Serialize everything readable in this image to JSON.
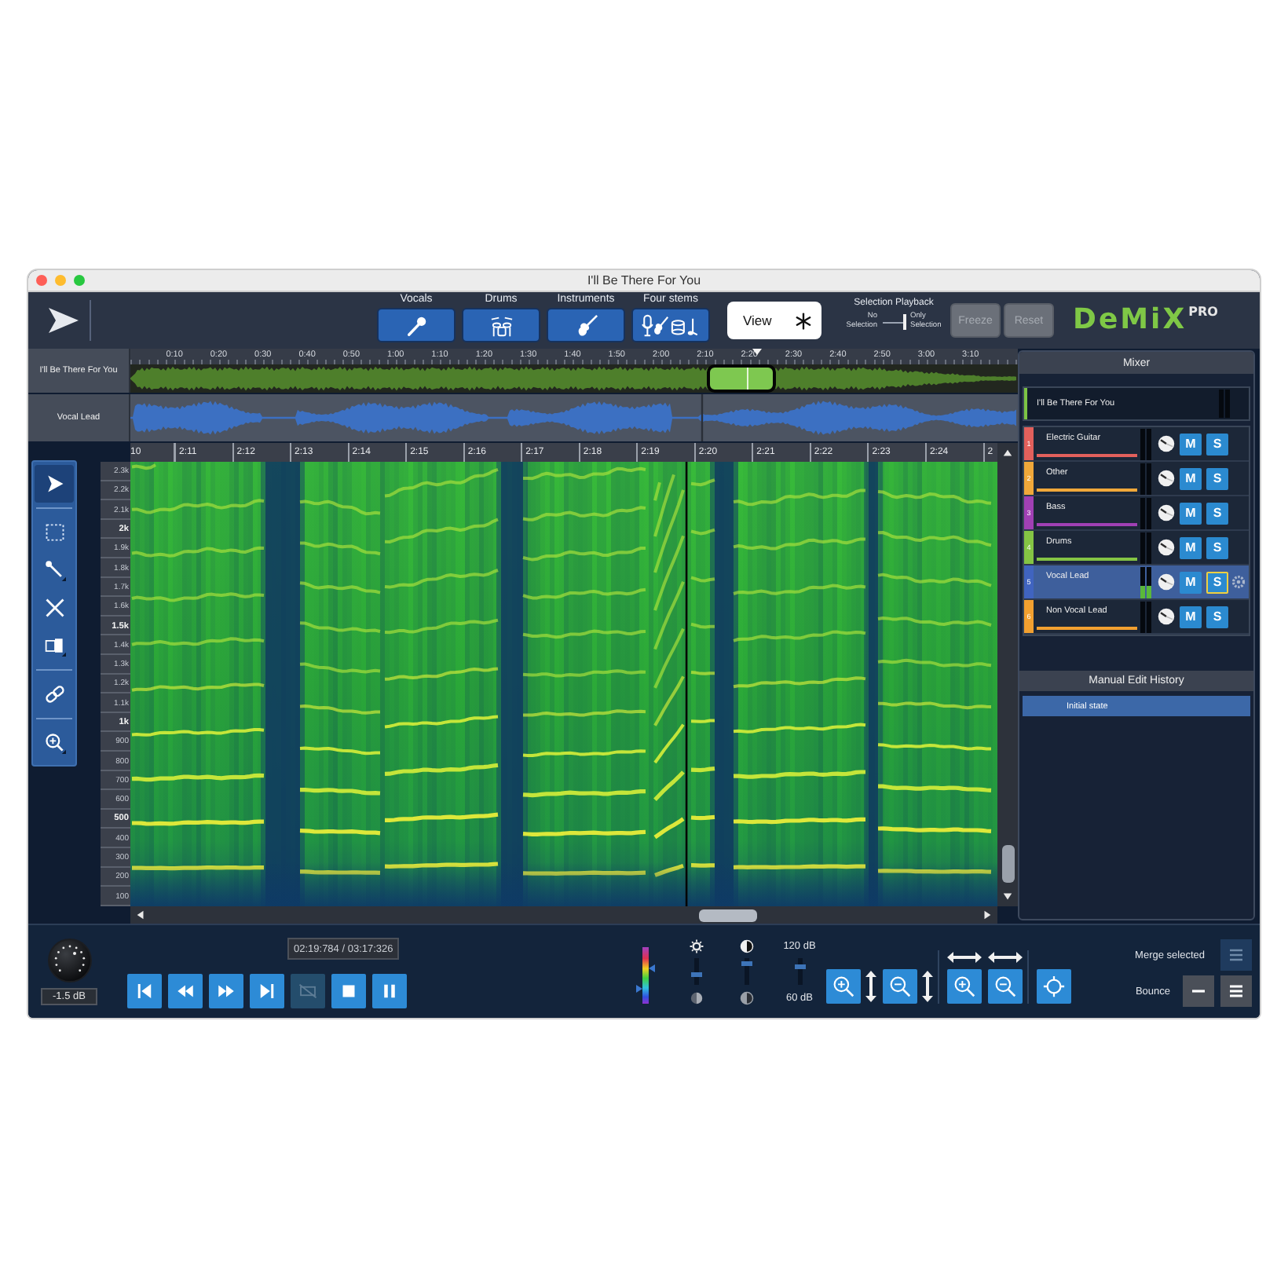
{
  "window": {
    "title": "I'll Be There For You"
  },
  "toolbar": {
    "stems": [
      {
        "label": "Vocals",
        "kind": "mic"
      },
      {
        "label": "Drums",
        "kind": "drums"
      },
      {
        "label": "Instruments",
        "kind": "guitar"
      },
      {
        "label": "Four stems",
        "kind": "all"
      }
    ],
    "view_button": {
      "label": "View"
    },
    "selection_playback": {
      "title": "Selection Playback",
      "off_label": "No Selection",
      "on_label": "Only Selection",
      "on": true
    },
    "buttons": [
      {
        "label": "Freeze",
        "disabled": true
      },
      {
        "label": "Reset",
        "disabled": true
      }
    ],
    "logo": {
      "name": "DeMiX",
      "edition": "PRO"
    }
  },
  "overview": {
    "ruler": [
      "0:10",
      "0:20",
      "0:30",
      "0:40",
      "0:50",
      "1:00",
      "1:10",
      "1:20",
      "1:30",
      "1:40",
      "1:50",
      "2:00",
      "2:10",
      "2:20",
      "2:30",
      "2:40",
      "2:50",
      "3:00",
      "3:10"
    ],
    "track": {
      "name": "I'll Be There For You"
    }
  },
  "vocal_track": {
    "name": "Vocal Lead"
  },
  "detail_ruler": [
    "10",
    "2:11",
    "2:12",
    "2:13",
    "2:14",
    "2:15",
    "2:16",
    "2:17",
    "2:18",
    "2:19",
    "2:20",
    "2:21",
    "2:22",
    "2:23",
    "2:24",
    "2"
  ],
  "tool_groups": [
    [
      {
        "kind": "pointer",
        "selected": true
      }
    ],
    [
      {
        "kind": "marquee",
        "selected": false
      },
      {
        "kind": "brush",
        "selected": false
      },
      {
        "kind": "eraser",
        "selected": false
      },
      {
        "kind": "split",
        "selected": false
      }
    ],
    [
      {
        "kind": "link",
        "selected": false
      }
    ],
    [
      {
        "kind": "zoom",
        "selected": false
      }
    ]
  ],
  "frequency_axis": [
    {
      "label": "2.3k",
      "major": false
    },
    {
      "label": "2.2k",
      "major": false
    },
    {
      "label": "2.1k",
      "major": false
    },
    {
      "label": "2k",
      "major": true
    },
    {
      "label": "1.9k",
      "major": false
    },
    {
      "label": "1.8k",
      "major": false
    },
    {
      "label": "1.7k",
      "major": false
    },
    {
      "label": "1.6k",
      "major": false
    },
    {
      "label": "1.5k",
      "major": true
    },
    {
      "label": "1.4k",
      "major": false
    },
    {
      "label": "1.3k",
      "major": false
    },
    {
      "label": "1.2k",
      "major": false
    },
    {
      "label": "1.1k",
      "major": false
    },
    {
      "label": "1k",
      "major": true
    },
    {
      "label": "900",
      "major": false
    },
    {
      "label": "800",
      "major": false
    },
    {
      "label": "700",
      "major": false
    },
    {
      "label": "600",
      "major": false
    },
    {
      "label": "500",
      "major": true
    },
    {
      "label": "400",
      "major": false
    },
    {
      "label": "300",
      "major": false
    },
    {
      "label": "200",
      "major": false
    },
    {
      "label": "100",
      "major": false
    }
  ],
  "mixer": {
    "title": "Mixer",
    "master": {
      "name": "I'll Be There For You"
    },
    "tracks": [
      {
        "number": "1",
        "name": "Electric Guitar",
        "color": "#e2605c",
        "selected": false,
        "level": 0,
        "mute": {
          "label": "M",
          "on": false
        },
        "solo": {
          "label": "S",
          "on": false
        }
      },
      {
        "number": "2",
        "name": "Other",
        "color": "#f0a83a",
        "selected": false,
        "level": 0,
        "mute": {
          "label": "M",
          "on": false
        },
        "solo": {
          "label": "S",
          "on": false
        }
      },
      {
        "number": "3",
        "name": "Bass",
        "color": "#a040b4",
        "selected": false,
        "level": 0,
        "mute": {
          "label": "M",
          "on": false
        },
        "solo": {
          "label": "S",
          "on": false
        }
      },
      {
        "number": "4",
        "name": "Drums",
        "color": "#84c444",
        "selected": false,
        "level": 0,
        "mute": {
          "label": "M",
          "on": false
        },
        "solo": {
          "label": "S",
          "on": false
        }
      },
      {
        "number": "5",
        "name": "Vocal Lead",
        "color": "#4064c0",
        "selected": true,
        "level": 0.4,
        "mute": {
          "label": "M",
          "on": false
        },
        "solo": {
          "label": "S",
          "on": true
        }
      },
      {
        "number": "6",
        "name": "Non Vocal Lead",
        "color": "#f2a030",
        "selected": false,
        "level": 0,
        "mute": {
          "label": "M",
          "on": false
        },
        "solo": {
          "label": "S",
          "on": false
        }
      }
    ]
  },
  "history": {
    "title": "Manual Edit History",
    "items": [
      {
        "label": "Initial state",
        "selected": true
      }
    ]
  },
  "bottom": {
    "gain": {
      "reading": "-1.5 dB"
    },
    "time": "02:19:784 / 03:17:326",
    "transport": [
      {
        "kind": "first",
        "disabled": false
      },
      {
        "kind": "rewind",
        "disabled": false
      },
      {
        "kind": "forward",
        "disabled": false
      },
      {
        "kind": "last",
        "disabled": false
      },
      {
        "kind": "loop",
        "disabled": true
      },
      {
        "kind": "stop",
        "disabled": false
      },
      {
        "kind": "pause",
        "disabled": false
      }
    ],
    "brightness": {
      "level": 0.35
    },
    "contrast": {
      "level": 0.85
    },
    "range": {
      "top_label": "120 dB",
      "bottom_label": "60 dB",
      "level": 0.75
    },
    "view_controls": [
      [
        {
          "kind": "vzoomin"
        },
        {
          "kind": "vzoomout"
        }
      ],
      [
        {
          "kind": "hzoomin"
        },
        {
          "kind": "hzoomout"
        }
      ],
      [
        {
          "kind": "fit"
        }
      ]
    ],
    "merge": {
      "label": "Merge selected",
      "disabled": true
    },
    "bounce": {
      "label": "Bounce",
      "buttons": [
        {
          "kind": "minus"
        },
        {
          "kind": "lines"
        }
      ]
    }
  }
}
